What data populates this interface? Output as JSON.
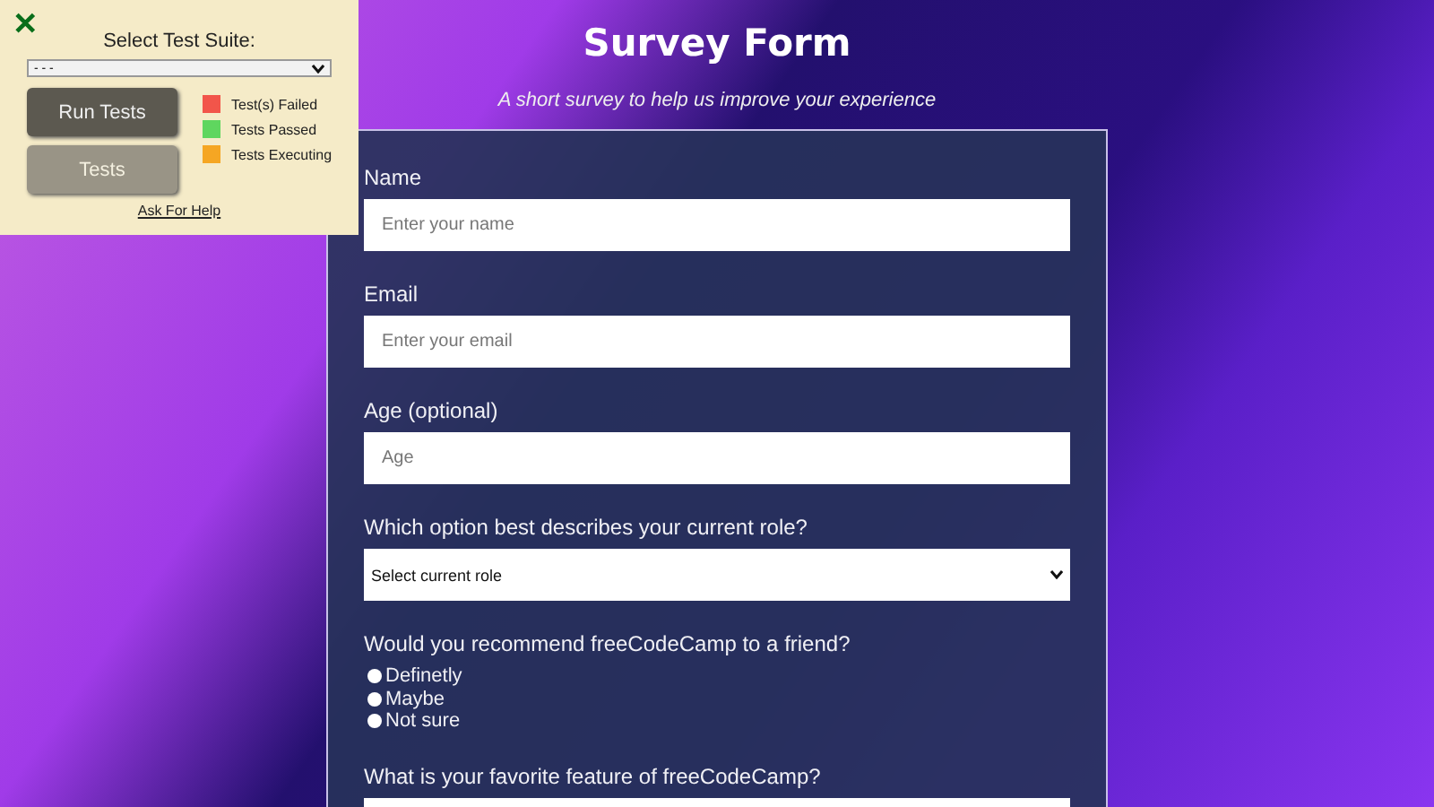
{
  "test_panel": {
    "close_icon": "✕",
    "suite_label": "Select Test Suite:",
    "suite_value": "- - -",
    "buttons": [
      {
        "label": "Run Tests",
        "kind": "primary"
      },
      {
        "label": "Tests",
        "kind": "secondary"
      }
    ],
    "legend": [
      {
        "label": "Test(s) Failed",
        "color": "#f2554a"
      },
      {
        "label": "Tests Passed",
        "color": "#5fd65f"
      },
      {
        "label": "Tests Executing",
        "color": "#f5a623"
      }
    ],
    "help_link": "Ask For Help"
  },
  "header": {
    "title": "Survey Form",
    "description": "A short survey to help us improve your experience"
  },
  "form": {
    "fields": [
      {
        "kind": "input",
        "label": "Name",
        "placeholder": "Enter your name"
      },
      {
        "kind": "input",
        "label": "Email",
        "placeholder": "Enter your email"
      },
      {
        "kind": "input",
        "label": "Age (optional)",
        "placeholder": "Age"
      },
      {
        "kind": "select",
        "label": "Which option best describes your current role?",
        "value": "Select current role"
      },
      {
        "kind": "radio",
        "label": "Would you recommend freeCodeCamp to a friend?",
        "options": [
          {
            "label": "Definetly",
            "selected": false
          },
          {
            "label": "Maybe",
            "selected": false
          },
          {
            "label": "Not sure",
            "selected": false
          }
        ]
      },
      {
        "kind": "input",
        "label": "What is your favorite feature of freeCodeCamp?"
      }
    ]
  }
}
